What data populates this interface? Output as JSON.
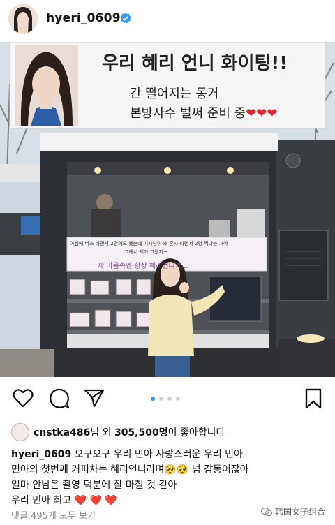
{
  "post": {
    "username": "hyeri_0609",
    "verified_icon": "verified-badge-icon"
  },
  "photo": {
    "banner_line1": "우리 혜리 언니 화이팅!!",
    "banner_line2": "간 떨어지는 동거",
    "banner_line3": "본방사수 벌써 준비 중",
    "banner_hearts": "❤❤❤",
    "truck_sign_line1": "아침에 버스 타면서 2명이요 했는데 기사님이 왜 혼자 타면서 2명 찍냐는 거야",
    "truck_sign_line2": "그래서 제가 그랬지~",
    "truck_sign_line3": "제 마음속엔 항상 혜리언니가..."
  },
  "actions": {
    "like_icon": "heart-outline-icon",
    "comment_icon": "comment-icon",
    "share_icon": "paper-plane-icon",
    "save_icon": "bookmark-icon",
    "carousel_count": 4,
    "carousel_active": 1
  },
  "likes": {
    "liker": "cnstka486",
    "text_mid": "님 외 ",
    "count": "305,500명",
    "text_end": "이 좋아합니다"
  },
  "caption": {
    "username": "hyeri_0609",
    "line1": " 오구오구 우리 민아 사랑스러운 우리 민아",
    "line2": "민아의 첫번째 커피차는 혜리언니라며🥺🥺 넘 감동이잖아",
    "line3": "얼마 안남은 촬영 덕분에 잘 마칠 것 같아",
    "line4": "우리 민아 최고 ",
    "line4_hearts": "❤️ ❤️ ❤️"
  },
  "comments": {
    "view_all": "댓글 495개 모두 보기"
  },
  "watermark": {
    "text": "韩国女子组合"
  }
}
